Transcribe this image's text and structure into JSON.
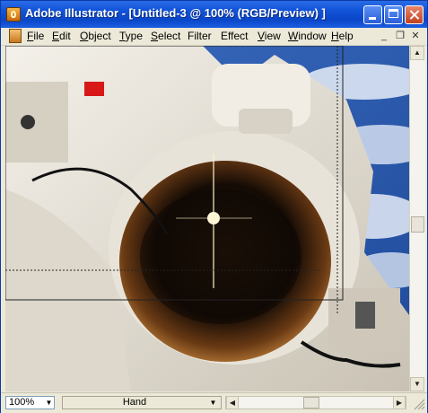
{
  "window": {
    "title": "Adobe Illustrator - [Untitled-3 @ 100% (RGB/Preview) ]",
    "icon": "illustrator-app-icon"
  },
  "menu": {
    "items": [
      {
        "first": "F",
        "rest": "ile"
      },
      {
        "first": "E",
        "rest": "dit"
      },
      {
        "first": "O",
        "rest": "bject"
      },
      {
        "first": "T",
        "rest": "ype"
      },
      {
        "first": "S",
        "rest": "elect"
      },
      {
        "first": "",
        "rest": "Filter"
      },
      {
        "first": "",
        "rest": "Effect"
      },
      {
        "first": "V",
        "rest": "iew"
      },
      {
        "first": "W",
        "rest": "indow"
      },
      {
        "first": "H",
        "rest": "elp"
      }
    ]
  },
  "status": {
    "zoom": "100%",
    "tool": "Hand"
  },
  "colors": {
    "titlebar": "#1254d8",
    "chrome": "#ece9d8",
    "sky": "#2b57a6"
  }
}
